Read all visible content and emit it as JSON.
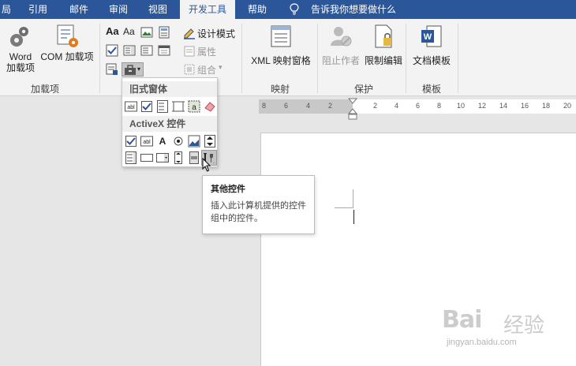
{
  "menubar": {
    "tabs": [
      "局",
      "引用",
      "邮件",
      "审阅",
      "视图",
      "开发工具",
      "帮助"
    ],
    "active_tab": "开发工具",
    "tell_me": "告诉我你想要做什么"
  },
  "ribbon": {
    "addins": {
      "word_addins": "Word\n加载项",
      "word_line1": "Word",
      "word_line2": "加载项",
      "com_addins": "COM 加载项",
      "group_label": "加载项"
    },
    "controls": {
      "design_mode": "设计模式",
      "properties": "属性",
      "group": "组合"
    },
    "mapping": {
      "xml_pane": "XML 映射窗格",
      "group_label": "映射"
    },
    "protect": {
      "block_authors": "阻止作者",
      "restrict_editing": "限制编辑",
      "group_label": "保护"
    },
    "templates": {
      "document_template": "文档模板",
      "group_label": "模板"
    }
  },
  "ruler": {
    "left_numbers": [
      "8",
      "6",
      "4",
      "2"
    ],
    "right_numbers": [
      "2",
      "4",
      "6",
      "8",
      "10",
      "12",
      "14",
      "16",
      "18",
      "20"
    ]
  },
  "dropdown": {
    "legacy_header": "旧式窗体",
    "activex_header": "ActiveX 控件"
  },
  "tooltip": {
    "title": "其他控件",
    "description": "插入此计算机提供的控件组中的控件。"
  },
  "watermark": {
    "brand": "Bai",
    "brand2": "经验",
    "url": "jingyan.baidu.com"
  },
  "colors": {
    "menubar_bg": "#2b579a",
    "ribbon_bg": "#f3f3f3",
    "accent_blue": "#2b579a",
    "com_orange": "#e07c1e"
  }
}
